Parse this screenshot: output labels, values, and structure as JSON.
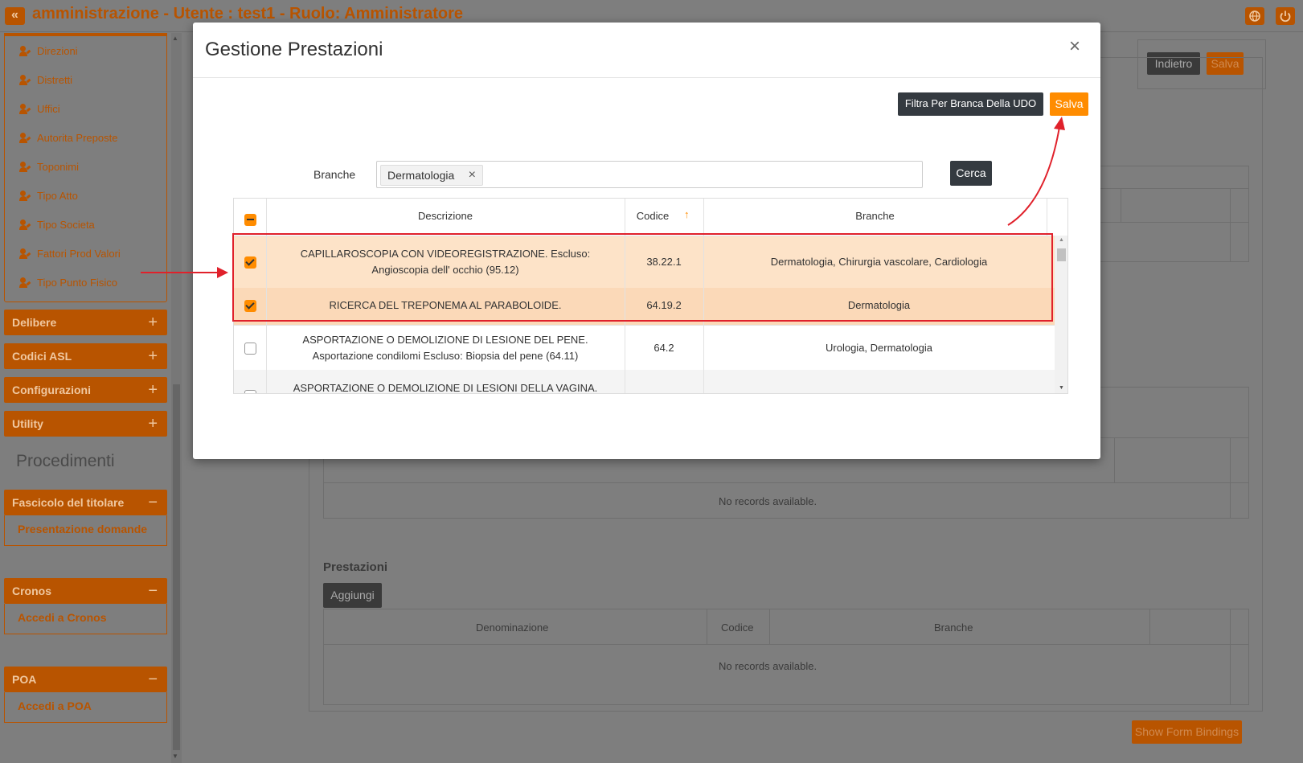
{
  "topbar": {
    "title": "amministrazione - Utente : test1 - Ruolo: Amministratore",
    "collapse_glyph": "«",
    "icons": [
      "globe-icon",
      "power-icon"
    ]
  },
  "sidebar": {
    "items": [
      {
        "label": "Direzioni"
      },
      {
        "label": "Distretti"
      },
      {
        "label": "Uffici"
      },
      {
        "label": "Autorita Preposte"
      },
      {
        "label": "Toponimi"
      },
      {
        "label": "Tipo Atto"
      },
      {
        "label": "Tipo Societa"
      },
      {
        "label": "Fattori Prod Valori"
      },
      {
        "label": "Tipo Punto Fisico"
      }
    ],
    "sections": [
      {
        "label": "Delibere",
        "symbol": "+"
      },
      {
        "label": "Codici ASL",
        "symbol": "+"
      },
      {
        "label": "Configurazioni",
        "symbol": "+"
      },
      {
        "label": "Utility",
        "symbol": "+"
      }
    ],
    "procedimenti_title": "Procedimenti",
    "fascicolo": {
      "label": "Fascicolo del titolare",
      "symbol": "−",
      "sub": "Presentazione domande"
    },
    "cronos": {
      "label": "Cronos",
      "symbol": "−",
      "sub": "Accedi a Cronos"
    },
    "poa": {
      "label": "POA",
      "symbol": "−",
      "sub": "Accedi a POA"
    }
  },
  "main": {
    "indietro": "Indietro",
    "salva": "Salva",
    "no_records": "No records available.",
    "prestazioni_title": "Prestazioni",
    "aggiungi": "Aggiungi",
    "columns": [
      "Denominazione",
      "Codice",
      "Branche"
    ],
    "show_bindings": "Show Form Bindings"
  },
  "modal": {
    "title": "Gestione Prestazioni",
    "close": "×",
    "filter_button": "Filtra Per Branca Della UDO",
    "save_button": "Salva",
    "filter_label": "Branche",
    "selected_tag": "Dermatologia",
    "tag_remove": "×",
    "search_button": "Cerca",
    "grid": {
      "headers": {
        "descrizione": "Descrizione",
        "codice": "Codice",
        "branche": "Branche",
        "sort_glyph": "↑"
      },
      "rows": [
        {
          "desc1": "CAPILLAROSCOPIA CON VIDEOREGISTRAZIONE. Escluso:",
          "desc2": "Angioscopia dell' occhio (95.12)",
          "code": "38.22.1",
          "branche": "Dermatologia, Chirurgia vascolare, Cardiologia",
          "checked": true
        },
        {
          "desc1": "RICERCA DEL TREPONEMA AL PARABOLOIDE.",
          "desc2": "",
          "code": "64.19.2",
          "branche": "Dermatologia",
          "checked": true
        },
        {
          "desc1": "ASPORTAZIONE O DEMOLIZIONE DI LESIONE DEL PENE.",
          "desc2": "Asportazione condilomi Escluso: Biopsia del pene (64.11)",
          "code": "64.2",
          "branche": "Urologia, Dermatologia",
          "checked": false
        },
        {
          "desc1": "ASPORTAZIONE O DEMOLIZIONE DI LESIONI DELLA VAGINA.",
          "desc2": "",
          "code": "",
          "branche": "",
          "checked": false
        }
      ]
    }
  },
  "colors": {
    "accent": "#ff8c00",
    "accent_dim": "#b85400",
    "annotation": "#e0212b",
    "selected_row": "#fde3c8"
  }
}
